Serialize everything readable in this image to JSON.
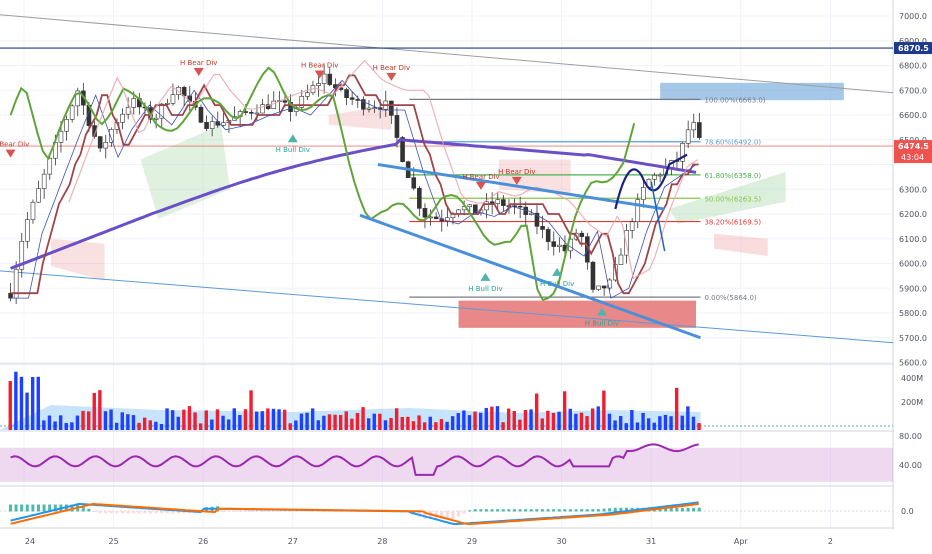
{
  "chart_data": {
    "type": "candlestick",
    "symbol_last_price": "6474.5",
    "countdown": "43:04",
    "reference_level": "6870.5",
    "price_axis_ticks": [
      "7000.0",
      "6900.0",
      "6800.0",
      "6700.0",
      "6600.0",
      "6500.0",
      "6300.0",
      "6200.0",
      "6100.0",
      "6000.0",
      "5900.0",
      "5800.0",
      "5700.0",
      "5600.0"
    ],
    "x_axis_ticks": [
      "24",
      "25",
      "26",
      "27",
      "28",
      "29",
      "30",
      "31",
      "Apr",
      "2"
    ],
    "fib_levels": [
      {
        "label": "100.00%(6663.0)",
        "value": 6663.0,
        "color": "#787b86"
      },
      {
        "label": "78.60%(6492.0)",
        "value": 6492.0,
        "color": "#5b9bd5"
      },
      {
        "label": "61.80%(6358.0)",
        "value": 6358.0,
        "color": "#4caf50"
      },
      {
        "label": "50.00%(6263.5)",
        "value": 6263.5,
        "color": "#8bc34a"
      },
      {
        "label": "38.20%(6169.5)",
        "value": 6169.5,
        "color": "#e53935"
      },
      {
        "label": "0.00%(5864.0)",
        "value": 5864.0,
        "color": "#787b86"
      }
    ],
    "annotations": [
      {
        "text": "H Bear Div",
        "kind": "bear",
        "day": 23.85,
        "price": 6460
      },
      {
        "text": "H Bear Div",
        "kind": "bear",
        "day": 25.95,
        "price": 6790
      },
      {
        "text": "H Bear Div",
        "kind": "bear",
        "day": 27.3,
        "price": 6780
      },
      {
        "text": "H Bear Div",
        "kind": "bear",
        "day": 28.1,
        "price": 6770
      },
      {
        "text": "H Bear Div",
        "kind": "bear",
        "day": 29.1,
        "price": 6330
      },
      {
        "text": "H Bear Div",
        "kind": "bear",
        "day": 29.5,
        "price": 6350
      },
      {
        "text": "H Bull Div",
        "kind": "bull",
        "day": 27.0,
        "price": 6490
      },
      {
        "text": "H Bull Div",
        "kind": "bull",
        "day": 29.15,
        "price": 5930
      },
      {
        "text": "H Bull Div",
        "kind": "bull",
        "day": 29.95,
        "price": 5950
      },
      {
        "text": "H Bull Div",
        "kind": "bull",
        "day": 30.45,
        "price": 5790
      }
    ],
    "volume_ticks": [
      "400M",
      "200M"
    ],
    "rsi_ticks": [
      "80.00",
      "40.00"
    ],
    "macd_ticks": [
      "0.0"
    ],
    "rsi_band": [
      30,
      70
    ]
  }
}
